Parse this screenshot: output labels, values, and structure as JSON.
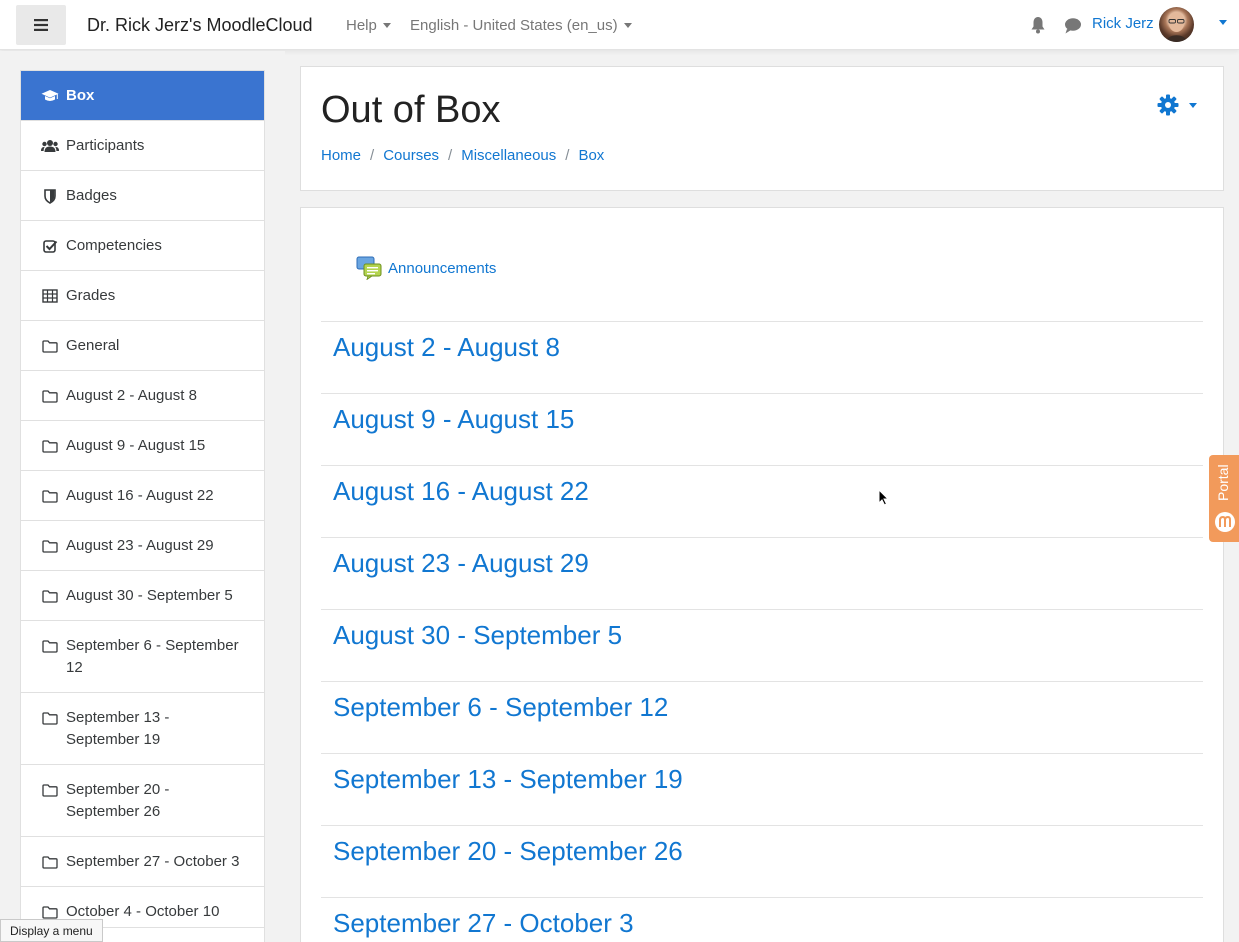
{
  "navbar": {
    "site_title": "Dr. Rick Jerz's MoodleCloud",
    "help_label": "Help",
    "language_label": "English - United States (en_us)",
    "user_name": "Rick Jerz"
  },
  "drawer": {
    "items": [
      {
        "label": "Box",
        "icon": "graduation-cap-icon",
        "active": true
      },
      {
        "label": "Participants",
        "icon": "users-icon"
      },
      {
        "label": "Badges",
        "icon": "shield-icon"
      },
      {
        "label": "Competencies",
        "icon": "checkbox-icon"
      },
      {
        "label": "Grades",
        "icon": "table-icon"
      },
      {
        "label": "General",
        "icon": "folder-icon"
      },
      {
        "label": "August 2 - August 8",
        "icon": "folder-icon"
      },
      {
        "label": "August 9 - August 15",
        "icon": "folder-icon"
      },
      {
        "label": "August 16 - August 22",
        "icon": "folder-icon"
      },
      {
        "label": "August 23 - August 29",
        "icon": "folder-icon"
      },
      {
        "label": "August 30 - September 5",
        "icon": "folder-icon"
      },
      {
        "label": "September 6 - September 12",
        "icon": "folder-icon"
      },
      {
        "label": "September 13 - September 19",
        "icon": "folder-icon"
      },
      {
        "label": "September 20 - September 26",
        "icon": "folder-icon"
      },
      {
        "label": "September 27 - October 3",
        "icon": "folder-icon"
      },
      {
        "label": "October 4 - October 10",
        "icon": "folder-icon"
      }
    ]
  },
  "tooltip": "Display a menu",
  "header": {
    "title": "Out of Box",
    "breadcrumb": [
      "Home",
      "Courses",
      "Miscellaneous",
      "Box"
    ]
  },
  "content": {
    "announcements_label": "Announcements",
    "sections": [
      "August 2 - August 8",
      "August 9 - August 15",
      "August 16 - August 22",
      "August 23 - August 29",
      "August 30 - September 5",
      "September 6 - September 12",
      "September 13 - September 19",
      "September 20 - September 26",
      "September 27 - October 3"
    ]
  },
  "portal_tab": "Portal",
  "colors": {
    "accent": "#1177d1",
    "active_item": "#3a74d0",
    "portal": "#f29a5b"
  }
}
